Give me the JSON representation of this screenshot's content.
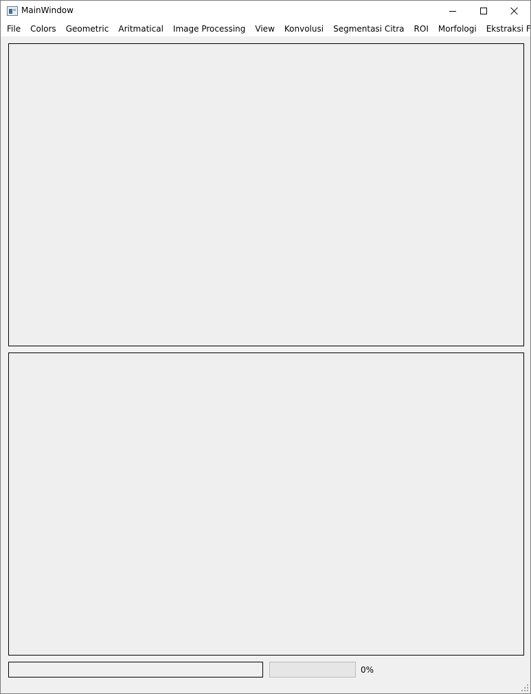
{
  "window": {
    "title": "MainWindow",
    "icon": "app-window-icon",
    "controls": [
      "minimize-icon",
      "maximize-icon",
      "close-icon"
    ]
  },
  "menubar": {
    "items": [
      {
        "label": "File"
      },
      {
        "label": "Colors"
      },
      {
        "label": "Geometric"
      },
      {
        "label": "Aritmatical"
      },
      {
        "label": "Image Processing"
      },
      {
        "label": "View"
      },
      {
        "label": "Konvolusi"
      },
      {
        "label": "Segmentasi Citra"
      },
      {
        "label": "ROI"
      },
      {
        "label": "Morfologi"
      },
      {
        "label": "Ekstraksi Fitur"
      }
    ]
  },
  "statusrow": {
    "line_edit_value": "",
    "progress_value": 0,
    "progress_text": "0%"
  },
  "colors": {
    "background": "#f0f0f0",
    "titlebar": "#ffffff",
    "panel_border": "#000000",
    "progress_chunk": "#06b025"
  }
}
